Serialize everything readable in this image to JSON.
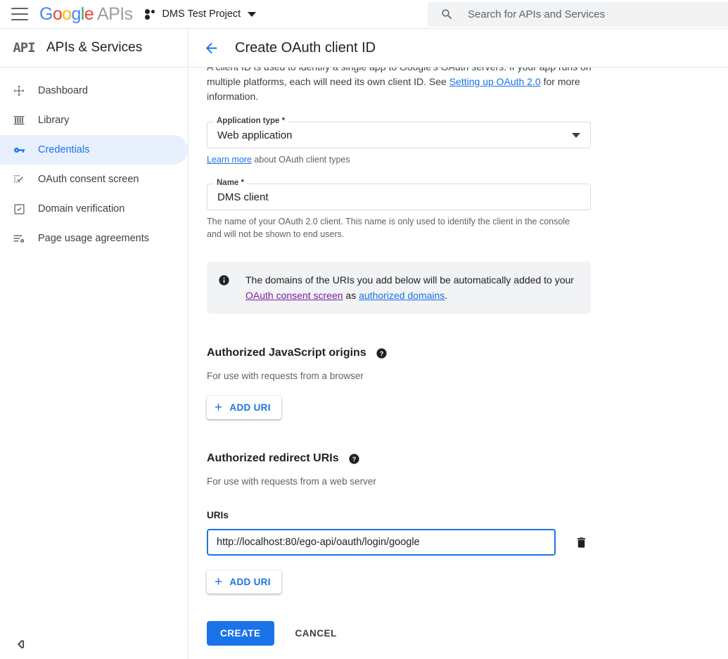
{
  "topbar": {
    "menu_icon": "hamburger-icon",
    "logo": {
      "g1": "G",
      "o1": "o",
      "o2": "o",
      "g2": "g",
      "l": "l",
      "e": "e",
      "suffix": "APIs"
    },
    "project_name": "DMS Test Project",
    "project_icon": "cloud-project-icon",
    "project_caret_icon": "chevron-down-icon",
    "search": {
      "icon": "search-icon",
      "placeholder": "Search for APIs and Services",
      "value": ""
    }
  },
  "sidebar": {
    "logo_text": "API",
    "title": "APIs & Services",
    "items": [
      {
        "label": "Dashboard",
        "icon": "dashboard-icon",
        "active": false
      },
      {
        "label": "Library",
        "icon": "library-icon",
        "active": false
      },
      {
        "label": "Credentials",
        "icon": "key-icon",
        "active": true
      },
      {
        "label": "OAuth consent screen",
        "icon": "consent-screen-icon",
        "active": false
      },
      {
        "label": "Domain verification",
        "icon": "checkbox-icon",
        "active": false
      },
      {
        "label": "Page usage agreements",
        "icon": "agreements-icon",
        "active": false
      }
    ],
    "collapse_icon": "collapse-panel-icon"
  },
  "header": {
    "back_icon": "back-arrow-icon",
    "title": "Create OAuth client ID"
  },
  "main": {
    "intro": {
      "part1": "A client ID is used to identify a single app to Google's OAuth servers. If your app runs on multiple platforms, each will need its own client ID. See ",
      "link": "Setting up OAuth 2.0",
      "part2": " for more information."
    },
    "application_type": {
      "label": "Application type *",
      "value": "Web application",
      "caret_icon": "chevron-down-icon",
      "helper_link": "Learn more",
      "helper_rest": " about OAuth client types"
    },
    "name": {
      "label": "Name *",
      "value": "DMS client",
      "helper": "The name of your OAuth 2.0 client. This name is only used to identify the client in the console and will not be shown to end users."
    },
    "banner": {
      "icon": "info-icon",
      "part1": "The domains of the URIs you add below will be automatically added to your ",
      "link1": "OAuth consent screen",
      "part2": " as ",
      "link2": "authorized domains",
      "part3": "."
    },
    "js_origins": {
      "title": "Authorized JavaScript origins",
      "help_icon": "help-icon",
      "subtitle": "For use with requests from a browser",
      "add_label": "ADD URI",
      "add_icon": "plus-icon"
    },
    "redirect_uris": {
      "title": "Authorized redirect URIs",
      "help_icon": "help-icon",
      "subtitle": "For use with requests from a web server",
      "uris_label": "URIs",
      "uri_value": "http://localhost:80/ego-api/oauth/login/google",
      "uri_placeholder": "",
      "delete_icon": "trash-icon",
      "add_label": "ADD URI",
      "add_icon": "plus-icon"
    },
    "actions": {
      "create_label": "CREATE",
      "cancel_label": "CANCEL"
    }
  },
  "colors": {
    "accent_blue": "#1a73e8",
    "visited_purple": "#7b1fa2",
    "active_nav_bg": "#e8f0fe",
    "surface_grey": "#f1f3f4"
  }
}
